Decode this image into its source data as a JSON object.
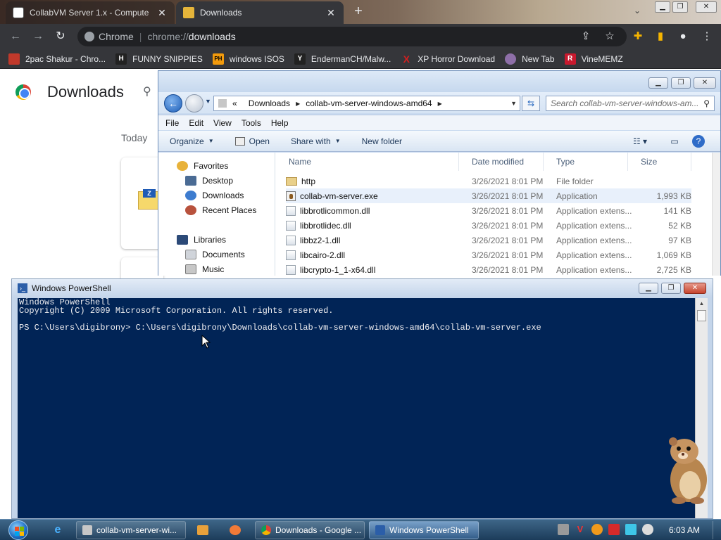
{
  "chrome": {
    "tabs": [
      {
        "title": "CollabVM Server 1.x - Compute",
        "active": false
      },
      {
        "title": "Downloads",
        "active": true
      }
    ],
    "omnibox": {
      "site_label": "Chrome",
      "scheme": "chrome://",
      "path": "downloads"
    },
    "bookmarks": [
      {
        "label": "2pac Shakur - Chro...",
        "icon": "2pac-icon",
        "color": "#c0392b"
      },
      {
        "label": "FUNNY SNIPPIES",
        "icon": "h-icon",
        "glyph": "H",
        "color": "#222222"
      },
      {
        "label": "windows ISOS",
        "icon": "ph-icon",
        "glyph": "PH",
        "color": "#f29a0c"
      },
      {
        "label": "EndermanCH/Malw...",
        "icon": "yp-icon",
        "glyph": "Y",
        "color": "#222222"
      },
      {
        "label": "XP Horror Download",
        "icon": "x-icon",
        "glyph": "X",
        "color": "#d41f1f"
      },
      {
        "label": "New Tab",
        "icon": "globe-icon",
        "color": "#8e6fa8"
      },
      {
        "label": "VineMEMZ",
        "icon": "r-icon",
        "glyph": "R",
        "color": "#c8192e"
      }
    ]
  },
  "downloads_page": {
    "title": "Downloads",
    "section": "Today",
    "file_icon_label": "Z"
  },
  "explorer": {
    "breadcrumb": [
      "Downloads",
      "collab-vm-server-windows-amd64"
    ],
    "breadcrumb_prefix": "«",
    "search_placeholder": "Search collab-vm-server-windows-am...",
    "menu": [
      "File",
      "Edit",
      "View",
      "Tools",
      "Help"
    ],
    "commands": [
      {
        "label": "Organize",
        "dropdown": true
      },
      {
        "label": "Open",
        "dropdown": false
      },
      {
        "label": "Share with",
        "dropdown": true
      },
      {
        "label": "New folder",
        "dropdown": false
      }
    ],
    "nav": {
      "favorites_label": "Favorites",
      "favorites": [
        "Desktop",
        "Downloads",
        "Recent Places"
      ],
      "libraries_label": "Libraries",
      "libraries": [
        "Documents",
        "Music"
      ]
    },
    "columns": {
      "name": "Name",
      "date": "Date modified",
      "type": "Type",
      "size": "Size"
    },
    "files": [
      {
        "name": "http",
        "date": "3/26/2021 8:01 PM",
        "type": "File folder",
        "size": "",
        "kind": "folder"
      },
      {
        "name": "collab-vm-server.exe",
        "date": "3/26/2021 8:01 PM",
        "type": "Application",
        "size": "1,993 KB",
        "kind": "exe",
        "selected": true
      },
      {
        "name": "libbrotlicommon.dll",
        "date": "3/26/2021 8:01 PM",
        "type": "Application extens...",
        "size": "141 KB",
        "kind": "dll"
      },
      {
        "name": "libbrotlidec.dll",
        "date": "3/26/2021 8:01 PM",
        "type": "Application extens...",
        "size": "52 KB",
        "kind": "dll"
      },
      {
        "name": "libbz2-1.dll",
        "date": "3/26/2021 8:01 PM",
        "type": "Application extens...",
        "size": "97 KB",
        "kind": "dll"
      },
      {
        "name": "libcairo-2.dll",
        "date": "3/26/2021 8:01 PM",
        "type": "Application extens...",
        "size": "1,069 KB",
        "kind": "dll"
      },
      {
        "name": "libcrypto-1_1-x64.dll",
        "date": "3/26/2021 8:01 PM",
        "type": "Application extens...",
        "size": "2,725 KB",
        "kind": "dll"
      }
    ]
  },
  "powershell": {
    "title": "Windows PowerShell",
    "lines": [
      "Windows PowerShell",
      "Copyright (C) 2009 Microsoft Corporation. All rights reserved.",
      "",
      "PS C:\\Users\\digibrony> C:\\Users\\digibrony\\Downloads\\collab-vm-server-windows-amd64\\collab-vm-server.exe"
    ],
    "bg_color": "#012456"
  },
  "taskbar": {
    "tasks": [
      {
        "label": "collab-vm-server-wi...",
        "icon": "folder-icon",
        "active": false
      },
      {
        "label": "Downloads - Google ...",
        "icon": "chrome-icon",
        "active": false
      },
      {
        "label": "Windows PowerShell",
        "icon": "powershell-icon",
        "active": true
      }
    ],
    "clock": "6:03 AM"
  }
}
